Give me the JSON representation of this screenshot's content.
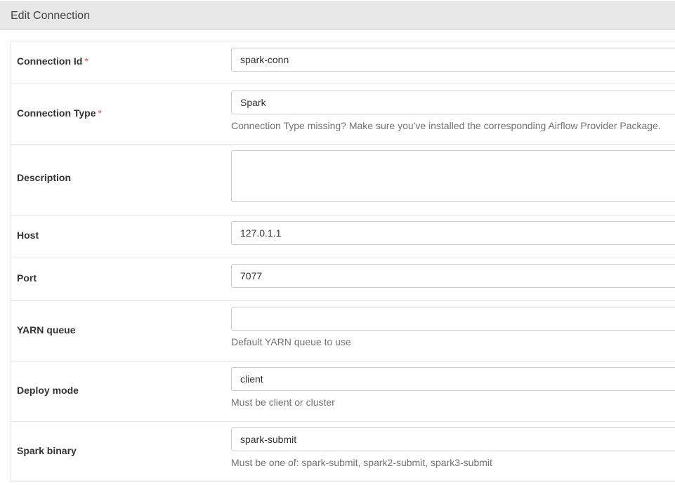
{
  "panel": {
    "title": "Edit Connection"
  },
  "required_marker": "*",
  "fields": {
    "conn_id": {
      "label": "Connection Id",
      "value": "spark-conn"
    },
    "conn_type": {
      "label": "Connection Type",
      "value": "Spark",
      "help": "Connection Type missing? Make sure you've installed the corresponding Airflow Provider Package."
    },
    "description": {
      "label": "Description",
      "value": ""
    },
    "host": {
      "label": "Host",
      "value": "127.0.1.1"
    },
    "port": {
      "label": "Port",
      "value": "7077"
    },
    "yarn_queue": {
      "label": "YARN queue",
      "value": "",
      "help": "Default YARN queue to use"
    },
    "deploy_mode": {
      "label": "Deploy mode",
      "value": "client",
      "help": "Must be client or cluster"
    },
    "spark_binary": {
      "label": "Spark binary",
      "value": "spark-submit",
      "help": "Must be one of: spark-submit, spark2-submit, spark3-submit"
    }
  },
  "colors": {
    "header_bg": "#e7e7e7",
    "required": "#d9534f",
    "help_text": "#737373",
    "border": "#cccccc"
  }
}
